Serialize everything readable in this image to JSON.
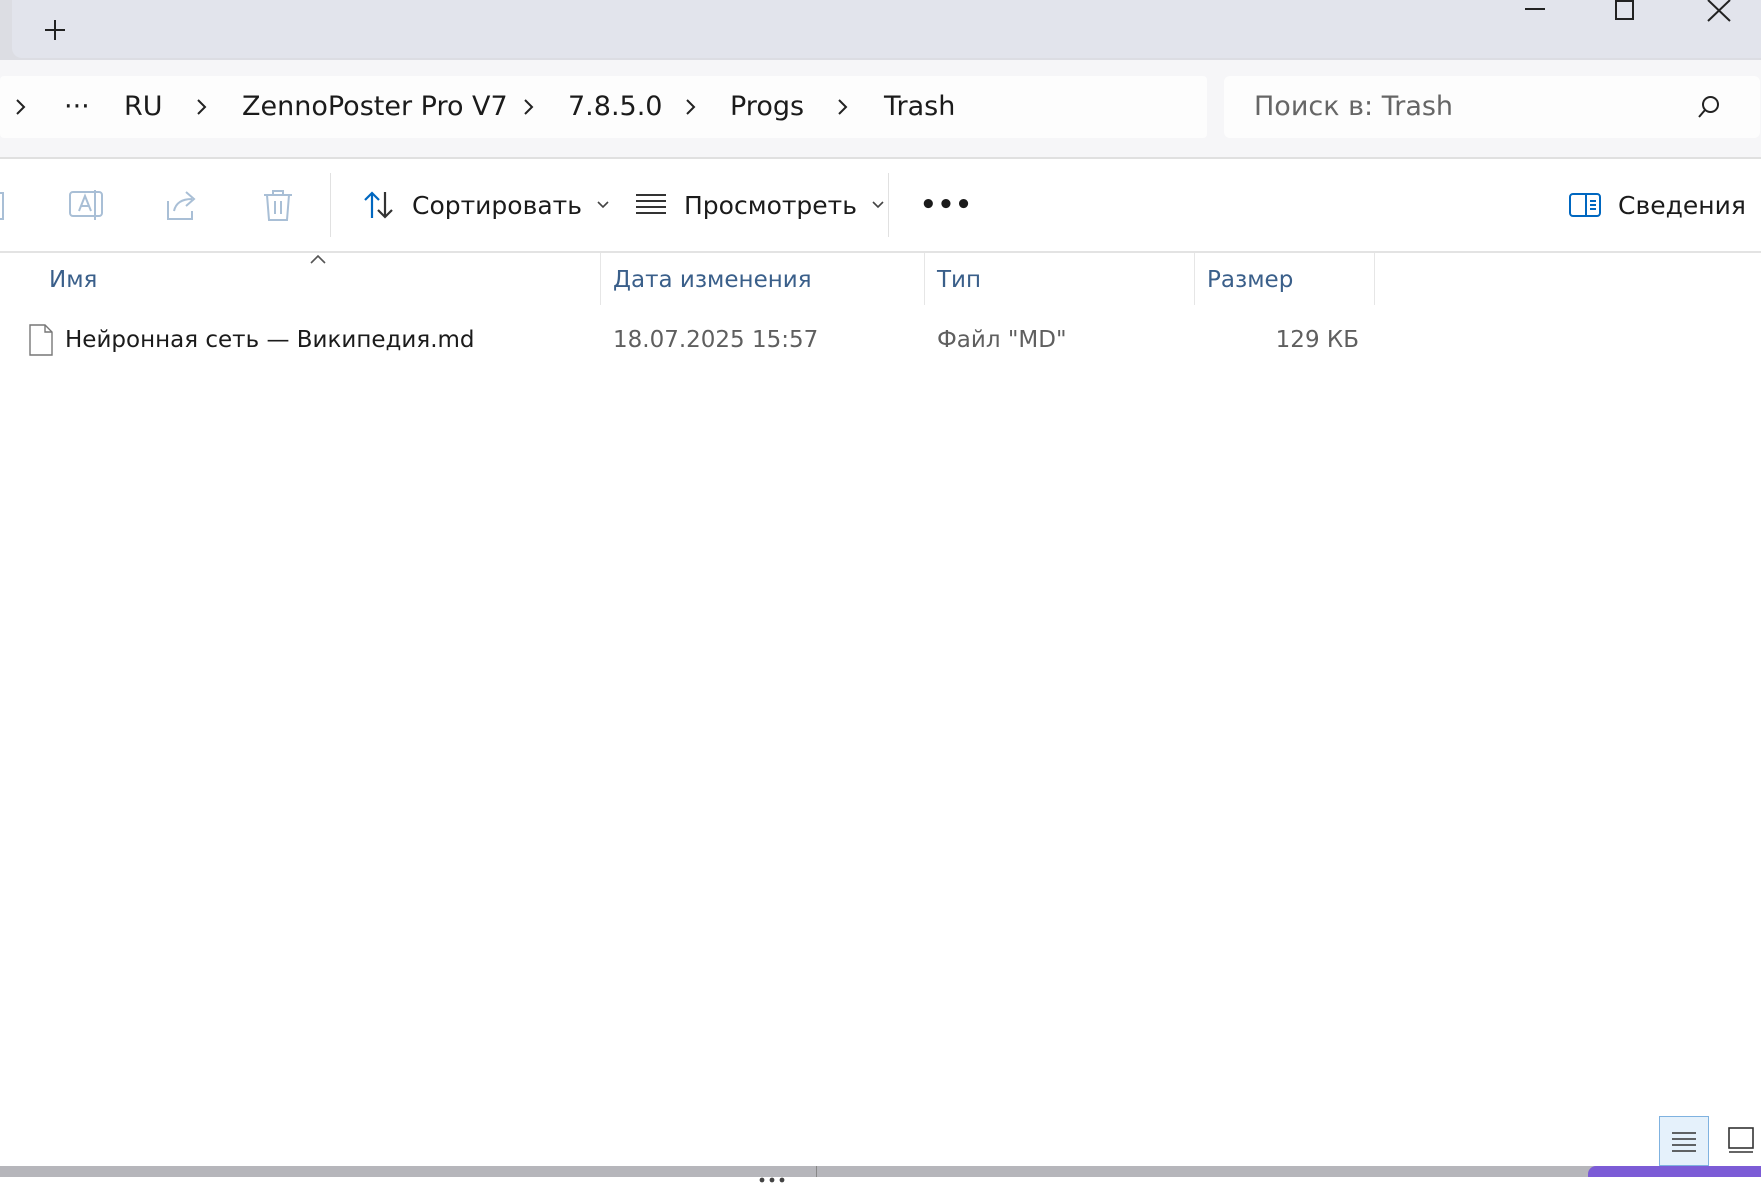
{
  "titlebar": {
    "new_tab_icon": "plus-icon",
    "window_controls": [
      "minimize-icon",
      "maximize-icon",
      "close-icon"
    ]
  },
  "breadcrumb": {
    "overflow": "···",
    "items": [
      "RU",
      "ZennoPoster Pro V7",
      "7.8.5.0",
      "Progs",
      "Trash"
    ]
  },
  "search": {
    "placeholder": "Поиск в: Trash"
  },
  "toolbar": {
    "sort_label": "Сортировать",
    "view_label": "Просмотреть",
    "more_label": "•••",
    "details_label": "Сведения"
  },
  "columns": {
    "name": "Имя",
    "date": "Дата изменения",
    "type": "Тип",
    "size": "Размер"
  },
  "files": [
    {
      "name": "Нейронная сеть — Википедия.md",
      "date": "18.07.2025 15:57",
      "type": "Файл \"MD\"",
      "size": "129 КБ"
    }
  ],
  "colors": {
    "accent": "#0067c0",
    "header_text": "#3a5f8a",
    "disabled_icon": "#a9bfd6"
  }
}
